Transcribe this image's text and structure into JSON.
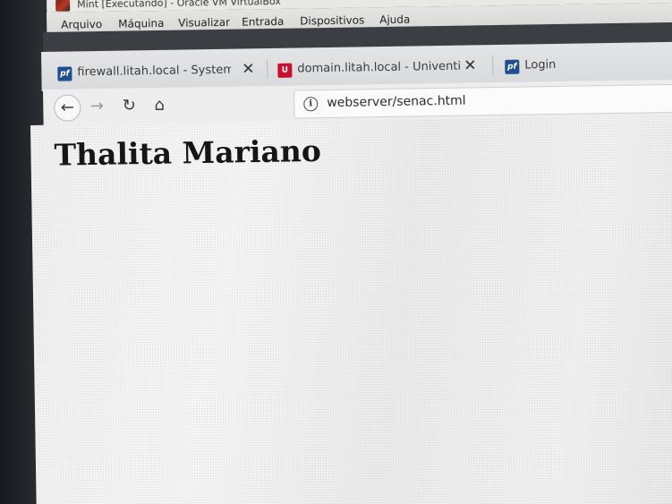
{
  "vm_window": {
    "title": "Mint [Executando] - Oracle VM VirtualBox",
    "menu": [
      "Arquivo",
      "Máquina",
      "Visualizar",
      "Entrada",
      "Dispositivos",
      "Ajuda"
    ]
  },
  "browser": {
    "tabs": [
      {
        "label": "firewall.litah.local - System: G",
        "favicon": "pf",
        "icon": "pfsense-favicon"
      },
      {
        "label": "domain.litah.local - Univention",
        "favicon": "U",
        "icon": "univention-favicon"
      },
      {
        "label": "Login",
        "favicon": "pf",
        "icon": "pfsense-favicon"
      }
    ],
    "tab_close_glyph": "✕",
    "url": "webserver/senac.html"
  },
  "page": {
    "heading": "Thalita Mariano"
  }
}
